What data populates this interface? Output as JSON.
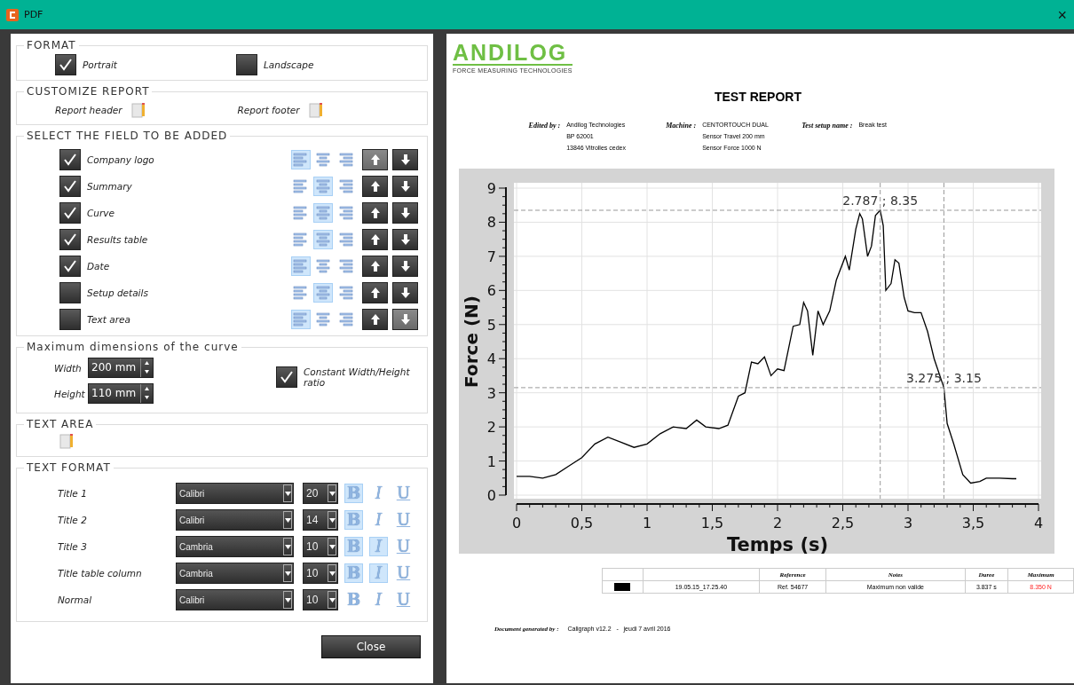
{
  "window": {
    "title": "PDF",
    "close": "×"
  },
  "format": {
    "title": "FORMAT",
    "options": [
      {
        "label": "Portrait",
        "checked": true
      },
      {
        "label": "Landscape",
        "checked": false
      }
    ]
  },
  "customize": {
    "title": "CUSTOMIZE REPORT",
    "items": [
      {
        "label": "Report header"
      },
      {
        "label": "Report footer"
      }
    ]
  },
  "fields": {
    "title": "SELECT THE FIELD TO BE ADDED",
    "rows": [
      {
        "label": "Company logo",
        "checked": true,
        "align_buttons": [
          {
            "kind": "left",
            "selected": true
          },
          {
            "kind": "center",
            "selected": false
          },
          {
            "kind": "right",
            "selected": false
          }
        ],
        "up_disabled": true,
        "down_disabled": false
      },
      {
        "label": "Summary",
        "checked": true,
        "align_buttons": [
          {
            "kind": "left",
            "selected": false
          },
          {
            "kind": "center",
            "selected": true
          },
          {
            "kind": "right",
            "selected": false
          }
        ],
        "up_disabled": false,
        "down_disabled": false
      },
      {
        "label": "Curve",
        "checked": true,
        "align_buttons": [
          {
            "kind": "left",
            "selected": false
          },
          {
            "kind": "center",
            "selected": true
          },
          {
            "kind": "right",
            "selected": false
          }
        ],
        "up_disabled": false,
        "down_disabled": false
      },
      {
        "label": "Results table",
        "checked": true,
        "align_buttons": [
          {
            "kind": "left",
            "selected": false
          },
          {
            "kind": "center",
            "selected": true
          },
          {
            "kind": "right",
            "selected": false
          }
        ],
        "up_disabled": false,
        "down_disabled": false
      },
      {
        "label": "Date",
        "checked": true,
        "align_buttons": [
          {
            "kind": "left",
            "selected": true
          },
          {
            "kind": "center",
            "selected": false
          },
          {
            "kind": "right",
            "selected": false
          }
        ],
        "up_disabled": false,
        "down_disabled": false
      },
      {
        "label": "Setup details",
        "checked": false,
        "align_buttons": [
          {
            "kind": "left",
            "selected": false
          },
          {
            "kind": "center",
            "selected": true
          },
          {
            "kind": "right",
            "selected": false
          }
        ],
        "up_disabled": false,
        "down_disabled": false
      },
      {
        "label": "Text area",
        "checked": false,
        "align_buttons": [
          {
            "kind": "left",
            "selected": true
          },
          {
            "kind": "center",
            "selected": false
          },
          {
            "kind": "right",
            "selected": false
          }
        ],
        "up_disabled": false,
        "down_disabled": true
      }
    ]
  },
  "dimensions": {
    "title": "Maximum dimensions of the curve",
    "width": {
      "label": "Width",
      "value": "200 mm"
    },
    "height": {
      "label": "Height",
      "value": "110 mm"
    },
    "ratio": {
      "label": "Constant Width/Height ratio",
      "checked": true
    }
  },
  "text_area": {
    "title": "TEXT AREA"
  },
  "text_format": {
    "title": "TEXT FORMAT",
    "rows": [
      {
        "label": "Title 1",
        "font": "Calibri",
        "size": "20",
        "styles": [
          {
            "kind": "bold",
            "text": "B",
            "selected": true
          },
          {
            "kind": "italic",
            "text": "I",
            "selected": false
          },
          {
            "kind": "underline",
            "text": "U",
            "selected": false
          }
        ]
      },
      {
        "label": "Title 2",
        "font": "Calibri",
        "size": "14",
        "styles": [
          {
            "kind": "bold",
            "text": "B",
            "selected": true
          },
          {
            "kind": "italic",
            "text": "I",
            "selected": false
          },
          {
            "kind": "underline",
            "text": "U",
            "selected": false
          }
        ]
      },
      {
        "label": "Title 3",
        "font": "Cambria",
        "size": "10",
        "styles": [
          {
            "kind": "bold",
            "text": "B",
            "selected": true
          },
          {
            "kind": "italic",
            "text": "I",
            "selected": true
          },
          {
            "kind": "underline",
            "text": "U",
            "selected": false
          }
        ]
      },
      {
        "label": "Title table column",
        "font": "Cambria",
        "size": "10",
        "styles": [
          {
            "kind": "bold",
            "text": "B",
            "selected": true
          },
          {
            "kind": "italic",
            "text": "I",
            "selected": true
          },
          {
            "kind": "underline",
            "text": "U",
            "selected": false
          }
        ]
      },
      {
        "label": "Normal",
        "font": "Calibri",
        "size": "10",
        "styles": [
          {
            "kind": "bold",
            "text": "B",
            "selected": false
          },
          {
            "kind": "italic",
            "text": "I",
            "selected": false
          },
          {
            "kind": "underline",
            "text": "U",
            "selected": false
          }
        ]
      }
    ]
  },
  "close_button": "Close",
  "report": {
    "logo": {
      "name": "ANDILOG",
      "tagline": "FORCE MEASURING TECHNOLOGIES"
    },
    "title": "TEST REPORT",
    "info": [
      {
        "label": "Edited by :",
        "lines": [
          "Andilog Technologies",
          "BP 62001",
          "13846 Vitrolles cedex"
        ]
      },
      {
        "label": "Machine :",
        "lines": [
          "CENTORTOUCH DUAL",
          "Sensor Travel 200 mm",
          "Sensor Force 1000 N"
        ]
      },
      {
        "label": "Test setup name :",
        "lines": [
          "Break test"
        ]
      }
    ],
    "chart_data": {
      "type": "line",
      "grid": true,
      "xlabel": "Temps (s)",
      "ylabel": "Force (N)",
      "xlim": [
        0,
        4
      ],
      "ylim": [
        0,
        9
      ],
      "xticks": [
        0,
        {
          "value": 0.5,
          "label": "0,5"
        },
        1,
        {
          "value": 1.5,
          "label": "1,5"
        },
        2,
        {
          "value": 2.5,
          "label": "2,5"
        },
        3,
        {
          "value": 3.5,
          "label": "3,5"
        },
        4
      ],
      "yticks": [
        0,
        1,
        2,
        3,
        4,
        5,
        6,
        7,
        8,
        9
      ],
      "x": [
        0,
        0.1,
        0.2,
        0.3,
        0.4,
        0.5,
        0.6,
        0.7,
        0.8,
        0.9,
        1.0,
        1.1,
        1.2,
        1.3,
        1.38,
        1.45,
        1.55,
        1.62,
        1.7,
        1.75,
        1.8,
        1.85,
        1.9,
        1.95,
        2.0,
        2.05,
        2.12,
        2.17,
        2.2,
        2.23,
        2.27,
        2.31,
        2.35,
        2.4,
        2.45,
        2.52,
        2.55,
        2.6,
        2.63,
        2.65,
        2.69,
        2.72,
        2.75,
        2.787,
        2.81,
        2.83,
        2.87,
        2.9,
        2.93,
        2.97,
        3.0,
        3.05,
        3.1,
        3.15,
        3.2,
        3.275,
        3.3,
        3.35,
        3.42,
        3.48,
        3.55,
        3.6,
        3.7,
        3.8,
        3.83
      ],
      "series": [
        {
          "color": "#000000",
          "values": [
            0.55,
            0.55,
            0.5,
            0.6,
            0.85,
            1.1,
            1.5,
            1.7,
            1.55,
            1.4,
            1.5,
            1.8,
            2.0,
            1.95,
            2.2,
            2.0,
            1.95,
            2.05,
            2.9,
            3.0,
            3.9,
            3.85,
            4.05,
            3.5,
            3.7,
            3.65,
            4.95,
            5.0,
            5.65,
            5.4,
            4.1,
            5.4,
            5.0,
            5.4,
            6.3,
            7.0,
            6.6,
            7.8,
            8.25,
            8.1,
            7.0,
            7.3,
            8.2,
            8.35,
            7.9,
            6.0,
            6.2,
            6.9,
            6.8,
            5.8,
            5.4,
            5.35,
            5.35,
            4.8,
            4.0,
            3.15,
            2.1,
            1.5,
            0.6,
            0.35,
            0.4,
            0.5,
            0.5,
            0.48,
            0.48
          ]
        }
      ],
      "annotations": [
        {
          "x": 2.787,
          "y": 8.35,
          "text": "2.787 ; 8.35"
        },
        {
          "x": 3.275,
          "y": 3.15,
          "text": "3.275 ; 3.15"
        }
      ]
    },
    "results": {
      "columns": [
        "",
        "",
        "Reference",
        "Notes",
        "Duree",
        "Maximum"
      ],
      "rows": [
        {
          "color": "#000000",
          "invalid": true,
          "cells": [
            "",
            "19.05.15_17.25.40",
            "Ref. 54677",
            "Maximum non valide",
            "3.837 s",
            "8.350 N"
          ]
        }
      ]
    },
    "footer": {
      "label": "Document generated by :",
      "text": "Caligraph v12.2   -   jeudi 7 avril 2016"
    }
  }
}
